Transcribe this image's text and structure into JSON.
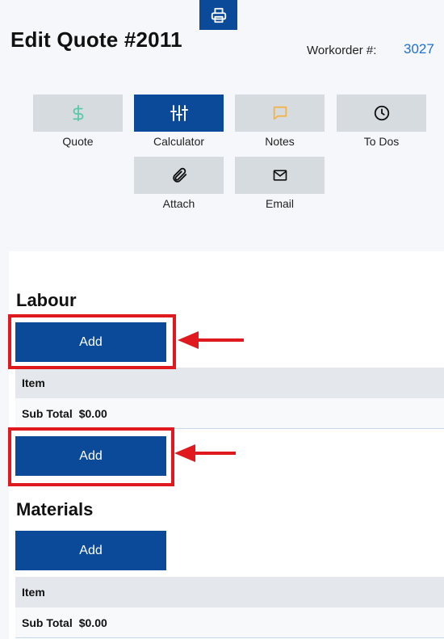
{
  "header": {
    "title": "Edit Quote #2011",
    "workorder_label": "Workorder #:",
    "workorder_value": "3027"
  },
  "tabs": [
    {
      "label": "Quote",
      "icon": "dollar-icon",
      "active": false
    },
    {
      "label": "Calculator",
      "icon": "sliders-icon",
      "active": true
    },
    {
      "label": "Notes",
      "icon": "chat-bubble-icon",
      "active": false
    },
    {
      "label": "To Dos",
      "icon": "clock-icon",
      "active": false
    },
    {
      "label": "Attach",
      "icon": "paperclip-icon",
      "active": false
    },
    {
      "label": "Email",
      "icon": "envelope-icon",
      "active": false
    }
  ],
  "sections": {
    "labour": {
      "title": "Labour",
      "add_label": "Add",
      "item_header": "Item",
      "subtotal_label": "Sub Total",
      "subtotal_value": "$0.00",
      "add_label_2": "Add"
    },
    "materials": {
      "title": "Materials",
      "add_label": "Add",
      "item_header": "Item",
      "subtotal_label": "Sub Total",
      "subtotal_value": "$0.00"
    }
  },
  "colors": {
    "primary": "#0b4a99",
    "tile": "#d6dbe0",
    "link": "#1f6fd1",
    "annotation": "#e0191e",
    "quote_icon": "#5cc9a7",
    "notes_icon": "#f2b34a"
  }
}
